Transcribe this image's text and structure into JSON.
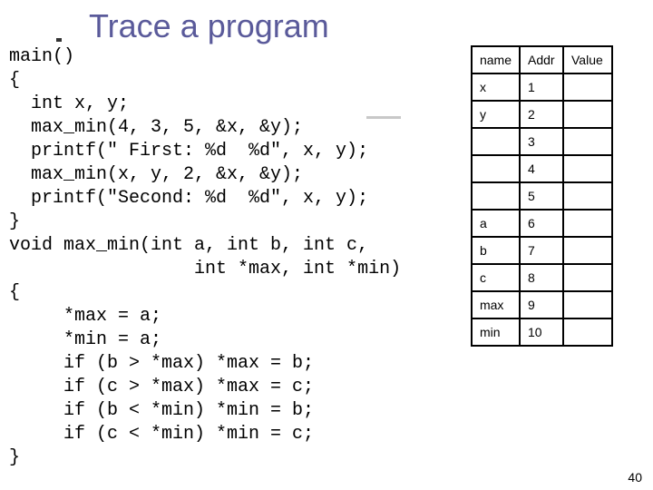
{
  "title": "Trace a program",
  "code_lines": [
    "main()",
    "{",
    "  int x, y;",
    "  max_min(4, 3, 5, &x, &y);",
    "  printf(\" First: %d  %d\", x, y);",
    "  max_min(x, y, 2, &x, &y);",
    "  printf(\"Second: %d  %d\", x, y);",
    "}",
    "void max_min(int a, int b, int c,",
    "                 int *max, int *min)",
    "{",
    "     *max = a;",
    "     *min = a;",
    "     if (b > *max) *max = b;",
    "     if (c > *max) *max = c;",
    "     if (b < *min) *min = b;",
    "     if (c < *min) *min = c;",
    "}"
  ],
  "table": {
    "headers": {
      "name": "name",
      "addr": "Addr",
      "value": "Value"
    },
    "rows": [
      {
        "name": "x",
        "addr": "1",
        "value": ""
      },
      {
        "name": "y",
        "addr": "2",
        "value": ""
      },
      {
        "name": "",
        "addr": "3",
        "value": ""
      },
      {
        "name": "",
        "addr": "4",
        "value": ""
      },
      {
        "name": "",
        "addr": "5",
        "value": ""
      },
      {
        "name": "a",
        "addr": "6",
        "value": ""
      },
      {
        "name": "b",
        "addr": "7",
        "value": ""
      },
      {
        "name": "c",
        "addr": "8",
        "value": ""
      },
      {
        "name": "max",
        "addr": "9",
        "value": ""
      },
      {
        "name": "min",
        "addr": "10",
        "value": ""
      }
    ]
  },
  "page_number": "40"
}
